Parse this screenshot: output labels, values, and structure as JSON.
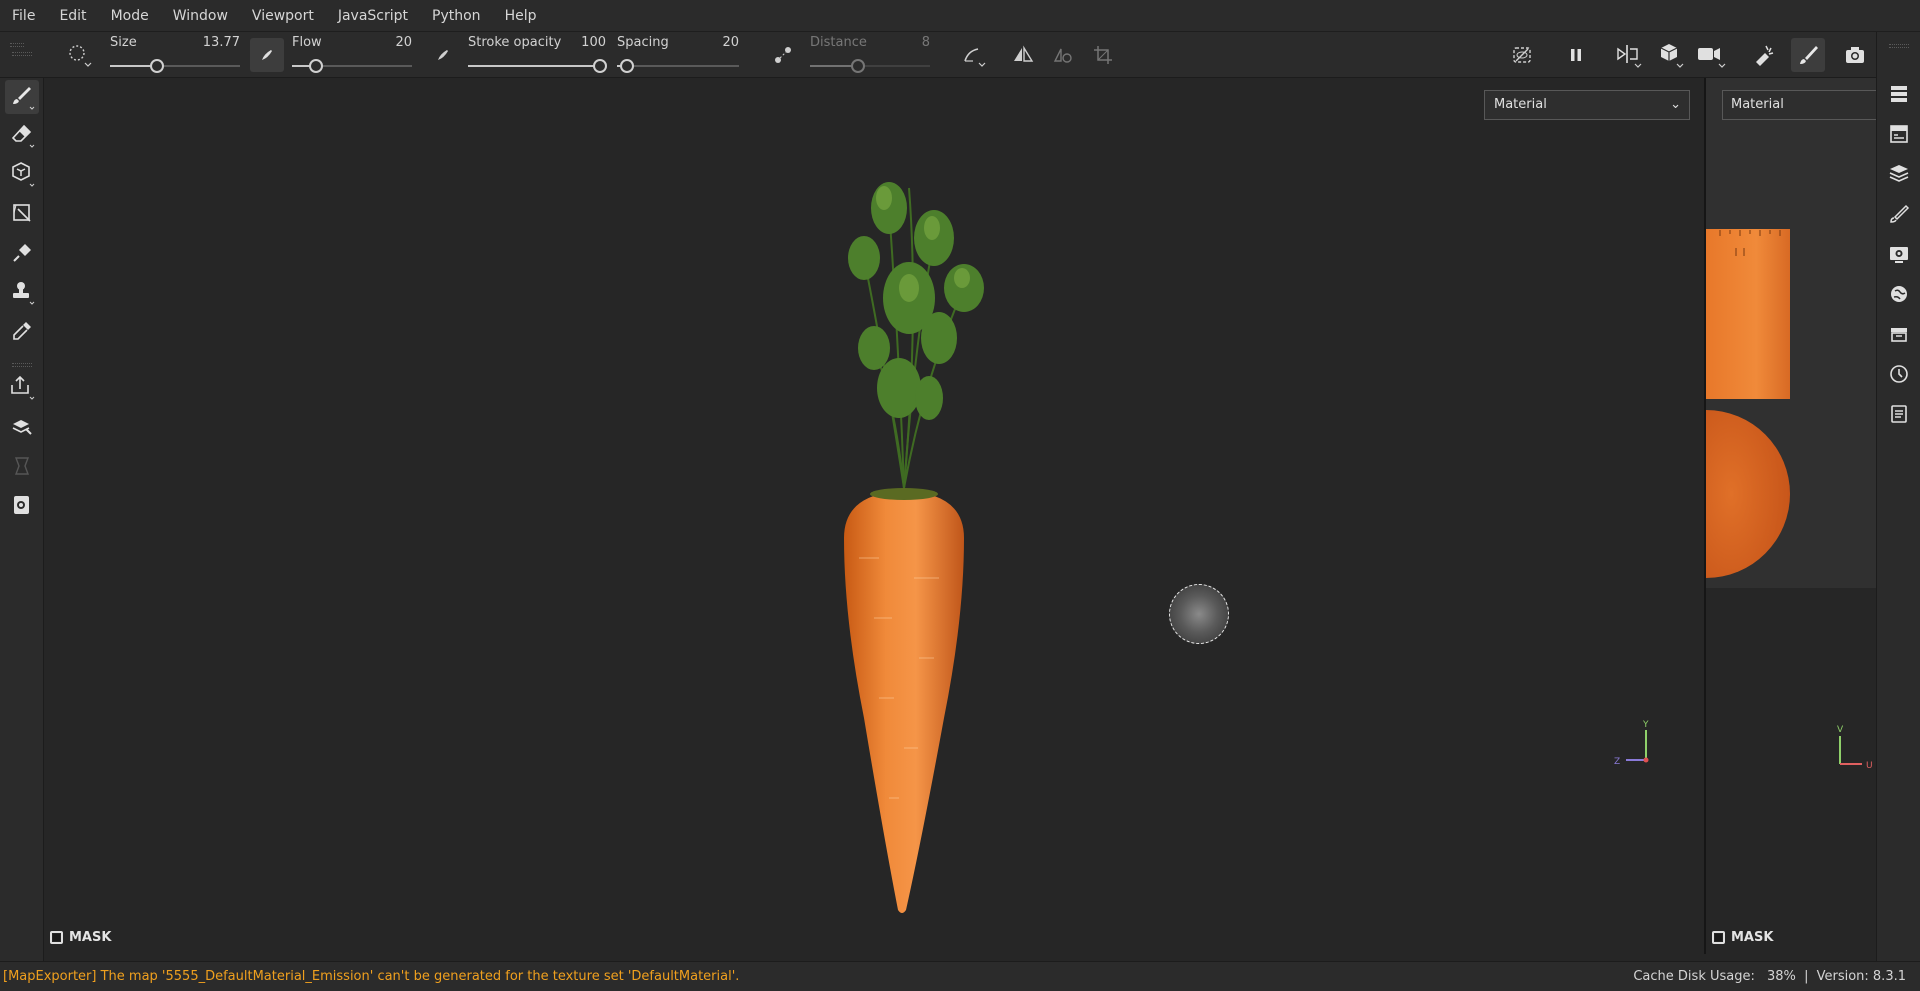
{
  "menubar": {
    "items": [
      "File",
      "Edit",
      "Mode",
      "Window",
      "Viewport",
      "JavaScript",
      "Python",
      "Help"
    ]
  },
  "toolbar": {
    "size": {
      "label": "Size",
      "value": "13.77",
      "fraction": 0.36
    },
    "flow": {
      "label": "Flow",
      "value": "20",
      "fraction": 0.2
    },
    "stroke_opacity": {
      "label": "Stroke opacity",
      "value": "100",
      "fraction": 1.0
    },
    "spacing": {
      "label": "Spacing",
      "value": "20",
      "fraction": 0.08
    },
    "distance": {
      "label": "Distance",
      "value": "8",
      "fraction": 0.4,
      "disabled": true
    }
  },
  "viewport": {
    "material_dropdown": "Material",
    "mask_label": "MASK",
    "gizmo": {
      "y": "Y",
      "z": "Z"
    }
  },
  "uv_view": {
    "material_dropdown": "Material",
    "mask_label": "MASK",
    "gizmo": {
      "v": "V",
      "u": "U"
    }
  },
  "left_tools": [
    "paint-brush-icon",
    "eraser-icon",
    "projection-icon",
    "polygon-fill-icon",
    "smudge-icon",
    "clone-stamp-icon",
    "color-picker-icon",
    "bake-export-icon",
    "material-picker-icon",
    "geometry-icon",
    "mesh-mask-icon"
  ],
  "right_tools": [
    "layers-list-icon",
    "texture-set-icon",
    "layer-stack-icon",
    "brush-properties-icon",
    "display-settings-icon",
    "environment-icon",
    "shelf-icon",
    "history-icon",
    "log-icon"
  ],
  "statusbar": {
    "message": "[MapExporter] The map '5555_DefaultMaterial_Emission' can't be generated for the texture set 'DefaultMaterial'.",
    "cache_label": "Cache Disk Usage:",
    "cache_value": "38%",
    "separator": "|",
    "version": "Version: 8.3.1"
  },
  "colors": {
    "accent_warning": "#f0a01e",
    "background": "#262626",
    "carrot": "#e8782a",
    "leaves": "#4a7a2a"
  }
}
